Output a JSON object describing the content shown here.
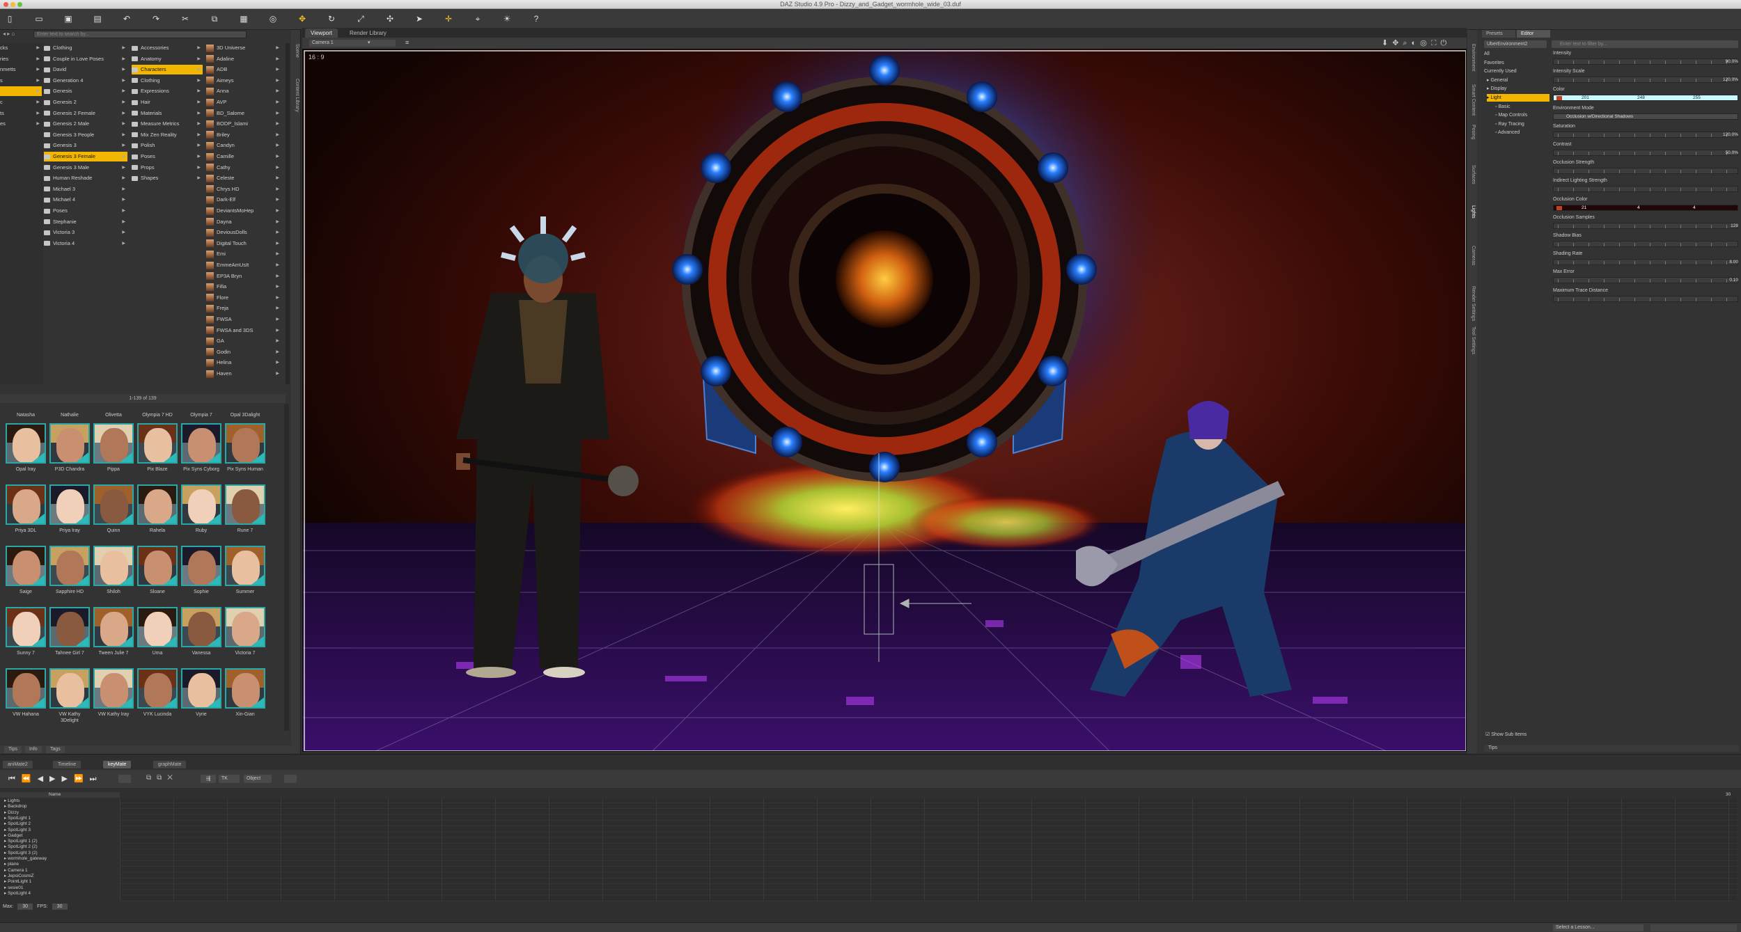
{
  "window": {
    "title": "DAZ Studio 4.9 Pro - Dizzy_and_Gadget_wormhole_wide_03.duf"
  },
  "toolbar": {
    "icons": [
      "new-icon",
      "open-icon",
      "save-icon",
      "save-as-icon",
      "undo-icon",
      "redo-icon",
      "cut-icon",
      "copy-icon",
      "paste-icon",
      "render-icon",
      "transform-icon",
      "rotate-icon",
      "scale-icon",
      "universal-icon",
      "node-select-icon",
      "move-icon",
      "camera-icon",
      "light-icon",
      "help-icon"
    ]
  },
  "content": {
    "search_placeholder": "Enter text to search by...",
    "col1": [
      "cks",
      "ries",
      "nmetts",
      "s",
      "",
      "c",
      "ts",
      "es"
    ],
    "col2": [
      "Clothing",
      "Couple in Love Poses",
      "David",
      "Generation 4",
      "Genesis",
      "Genesis 2",
      "Genesis 2 Female",
      "Genesis 2 Male",
      "Genesis 3 People",
      "Genesis 3",
      "Genesis 3 Female",
      "Genesis 3 Male",
      "Human Reshade",
      "Michael 3",
      "Michael 4",
      "Poses",
      "Stephanie",
      "Victoria 3",
      "Victoria 4"
    ],
    "col2_selected": 10,
    "col3": [
      "Accessories",
      "Anatomy",
      "Characters",
      "Clothing",
      "Expressions",
      "Hair",
      "Materials",
      "Measure Metrics",
      "Mix Zen Reality",
      "Polish",
      "Poses",
      "Props",
      "Shapes"
    ],
    "col3_selected": 2,
    "col4": [
      "3D Universe",
      "Adaline",
      "ADB",
      "Aimeys",
      "Anna",
      "AVP",
      "BD_Salome",
      "BODP_Islami",
      "Briley",
      "Candyn",
      "Camille",
      "Cathy",
      "Celeste",
      "Chrys HD",
      "Dark-Elf",
      "DeviantsMoHep",
      "Dayna",
      "DeviousDolls",
      "Digital Touch",
      "Emi",
      "EmmeAmUsIt",
      "EP3A Bryn",
      "Fifia",
      "Flore",
      "Freja",
      "FWSA",
      "FWSA and 3DS",
      "GA",
      "Godin",
      "Helina",
      "Haven"
    ],
    "pager": "1-139 of 139",
    "grid_top_names": [
      "Natasha",
      "Nathalie",
      "Olivetta",
      "Olympia 7 HD",
      "Olympia 7",
      "Opal 3Dalight"
    ],
    "grid": [
      [
        "Opal Iray",
        "P3D Chandra",
        "Pippa",
        "Pix Blaze",
        "Pix Syns Cyborg",
        "Pix Syns Human"
      ],
      [
        "Priya 3DL",
        "Priya Iray",
        "Quinn",
        "Rahela",
        "Ruby",
        "Rune 7"
      ],
      [
        "Saige",
        "Sapphire HD",
        "Shiloh",
        "Sloane",
        "Sophie",
        "Summer"
      ],
      [
        "Sunny 7",
        "Tahnee Girl 7",
        "Tween Julie 7",
        "Uma",
        "Vanessa",
        "Victoria 7"
      ],
      [
        "VW Hahana",
        "VW Kathy 3Delight",
        "VW Kathy Iray",
        "VYK Lucinda",
        "Vyrie",
        "Xin-Gian"
      ]
    ],
    "left_tabs": [
      "Tips",
      "Info",
      "Tags"
    ]
  },
  "side_tabs_left": [
    "Scene",
    "Content Library"
  ],
  "viewport": {
    "tabs": [
      "Viewport",
      "Render Library"
    ],
    "camera": "Camera 1",
    "aspect": "16 : 9"
  },
  "side_tabs_right": [
    "Environment",
    "Smart Content",
    "Posing",
    "Surfaces",
    "Lights",
    "Cameras",
    "Render Settings",
    "Tool Settings"
  ],
  "lights_panel": {
    "tabs": [
      "Presets",
      "Editor"
    ],
    "node": "UberEnvironment2",
    "filter_placeholder": "Enter text to filter by...",
    "tree": [
      "All",
      "Favorites",
      "Currently Used",
      "General",
      "Display",
      "Light",
      "Basic",
      "Map Controls",
      "Ray Tracing",
      "Advanced"
    ],
    "tree_selected": 5,
    "show_sub_items": "Show Sub Items",
    "props": [
      {
        "label": "Intensity",
        "value": "90.0%"
      },
      {
        "label": "Intensity Scale",
        "value": "120.0%"
      },
      {
        "label": "Color",
        "value": "",
        "color": [
          201,
          248,
          255
        ]
      },
      {
        "label": "Environment Mode",
        "value": "Occlusion w/Directional Shadows"
      },
      {
        "label": "Saturation",
        "value": "120.0%"
      },
      {
        "label": "Contrast",
        "value": "50.0%"
      },
      {
        "label": "Occlusion Strength",
        "value": ""
      },
      {
        "label": "Indirect Lighting Strength",
        "value": ""
      },
      {
        "label": "Occlusion Color",
        "value": "",
        "color": [
          21,
          4,
          4
        ]
      },
      {
        "label": "Occlusion Samples",
        "value": "128"
      },
      {
        "label": "Shadow Bias",
        "value": ""
      },
      {
        "label": "Shading Rate",
        "value": "8.00"
      },
      {
        "label": "Max Error",
        "value": "0.10"
      },
      {
        "label": "Maximum Trace Distance",
        "value": ""
      }
    ],
    "tips": "Tips"
  },
  "timeline": {
    "tabs": [
      "aniMate2",
      "Timeline",
      "keyMate",
      "graphMate"
    ],
    "active_tab": 2,
    "tk_label": "TK",
    "object_label": "Object",
    "name_header": "Name",
    "frame_end": "30",
    "rows": [
      "Lights",
      "Backdrop",
      "Dizzy",
      "SpotLight 1",
      "SpotLight 2",
      "SpotLight 3",
      "Gadget",
      "SpotLight 1 (2)",
      "SpotLight 2 (2)",
      "SpotLight 3 (2)",
      "wormhole_gateway",
      "plane",
      "Camera 1",
      "JepsiCosmiZ",
      "PointLight 1",
      "sesie01",
      "SpotLight 4"
    ],
    "max_label": "Max:",
    "max_value": "30",
    "fps_label": "FPS:",
    "fps_value": "30"
  },
  "status": {
    "lesson": "Select a Lesson..."
  }
}
